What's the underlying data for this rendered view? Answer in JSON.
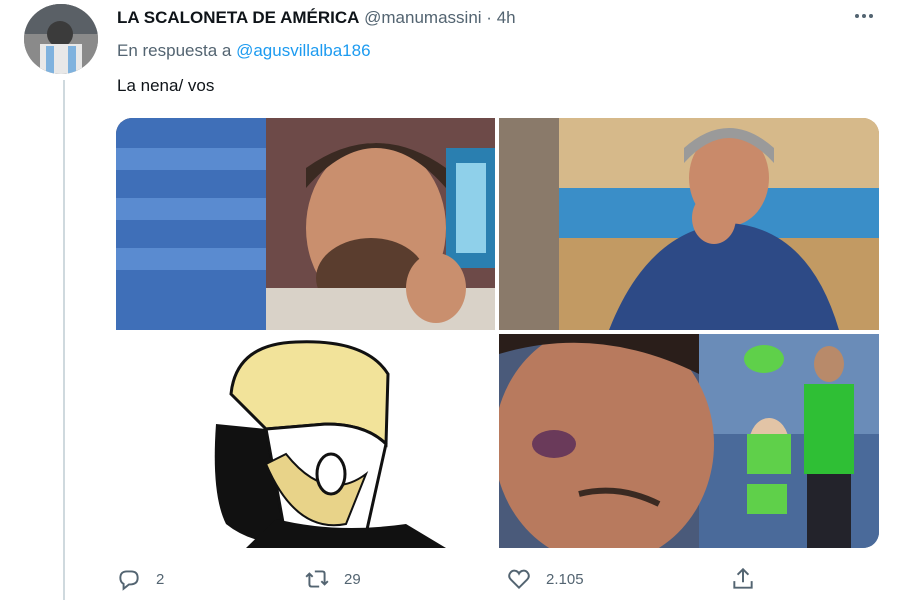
{
  "tweet": {
    "display_name": "LA SCALONETA DE AMÉRICA",
    "handle": "@manumassini",
    "separator": "·",
    "time": "4h",
    "reply_prefix": "En respuesta a",
    "reply_mention": "@agusvillalba186",
    "text": "La nena/ vos"
  },
  "media": [
    {
      "icon": "photo-man-laughing-phone"
    },
    {
      "icon": "photo-man-grey-hair-laughing"
    },
    {
      "icon": "photo-yes-chad-meme"
    },
    {
      "icon": "photo-man-crying-and-dancers"
    }
  ],
  "actions": {
    "reply_count": "2",
    "retweet_count": "29",
    "like_count": "2.105"
  },
  "colors": {
    "accent": "#1d9bf0",
    "secondary_text": "#536471",
    "thread_line": "#cfd9de"
  }
}
